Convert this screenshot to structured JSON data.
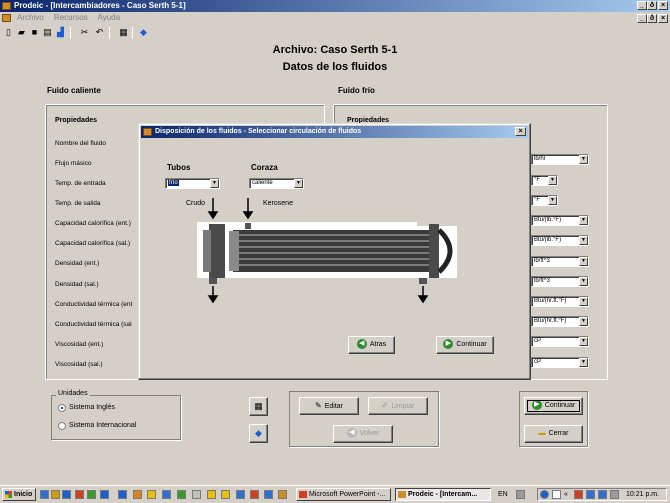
{
  "window": {
    "title": "Prodeic - [Intercambiadores - Caso Serth 5-1]",
    "controls": {
      "minimize": "_",
      "restore": "ð",
      "close": "×"
    }
  },
  "menu": [
    "Archivo",
    "Recursos",
    "Ayuda"
  ],
  "header": {
    "line1": "Archivo:  Caso Serth 5-1",
    "line2": "Datos de los fluidos"
  },
  "hot_fluid": {
    "label": "Fuido caliente",
    "props_header": "Propiedades",
    "rows": [
      "Nombre del fluido",
      "Flujo másico",
      "Temp. de entrada",
      "Temp. de salida",
      "Capacidad calorífica (ent.)",
      "Capacidad calorífica (sal.)",
      "Densidad (ent.)",
      "Densidad (sal.)",
      "Conductividad térmica (ent",
      "Conductividad térmica (sal",
      "Viscosidad (ent.)",
      "Viscosidad (sal.)"
    ]
  },
  "cold_fluid": {
    "label": "Fuido frío",
    "props_header": "Propiedades",
    "units": [
      "lb/hr",
      "°F",
      "°F",
      "Btu/(lb.°F)",
      "Btu/(lb.°F)",
      "lb/ft^3",
      "lb/ft^3",
      "Btu/(hr.ft.°F)",
      "Btu/(hr.ft.°F)",
      "cP",
      "cP"
    ]
  },
  "units_group": {
    "legend": "Unidades",
    "options": [
      "Sistema Inglés",
      "Sistema Internacional"
    ],
    "selected": "Sistema Inglés"
  },
  "buttons": {
    "editar": "Editar",
    "limpiar": "Limpiar",
    "volver": "Volver",
    "continuar": "Continuar",
    "cerrar": "Cerrar"
  },
  "dialog": {
    "title": "Disposición de los fluidos - Seleccionar circulación de fluidos",
    "close": "×",
    "tubos_label": "Tubos",
    "coraza_label": "Coraza",
    "tubos_value": "frío",
    "coraza_value": "caliente",
    "tube_fluid_name": "Crudo",
    "shell_fluid_name": "Kerosene",
    "back_button": "Atras",
    "continue_button": "Continuar"
  },
  "taskbar": {
    "start": "Inicio",
    "tasks": [
      "Microsoft PowerPoint -...",
      "Prodeic - [Intercam..."
    ],
    "language": "EN",
    "clock": "10:21 p.m."
  }
}
